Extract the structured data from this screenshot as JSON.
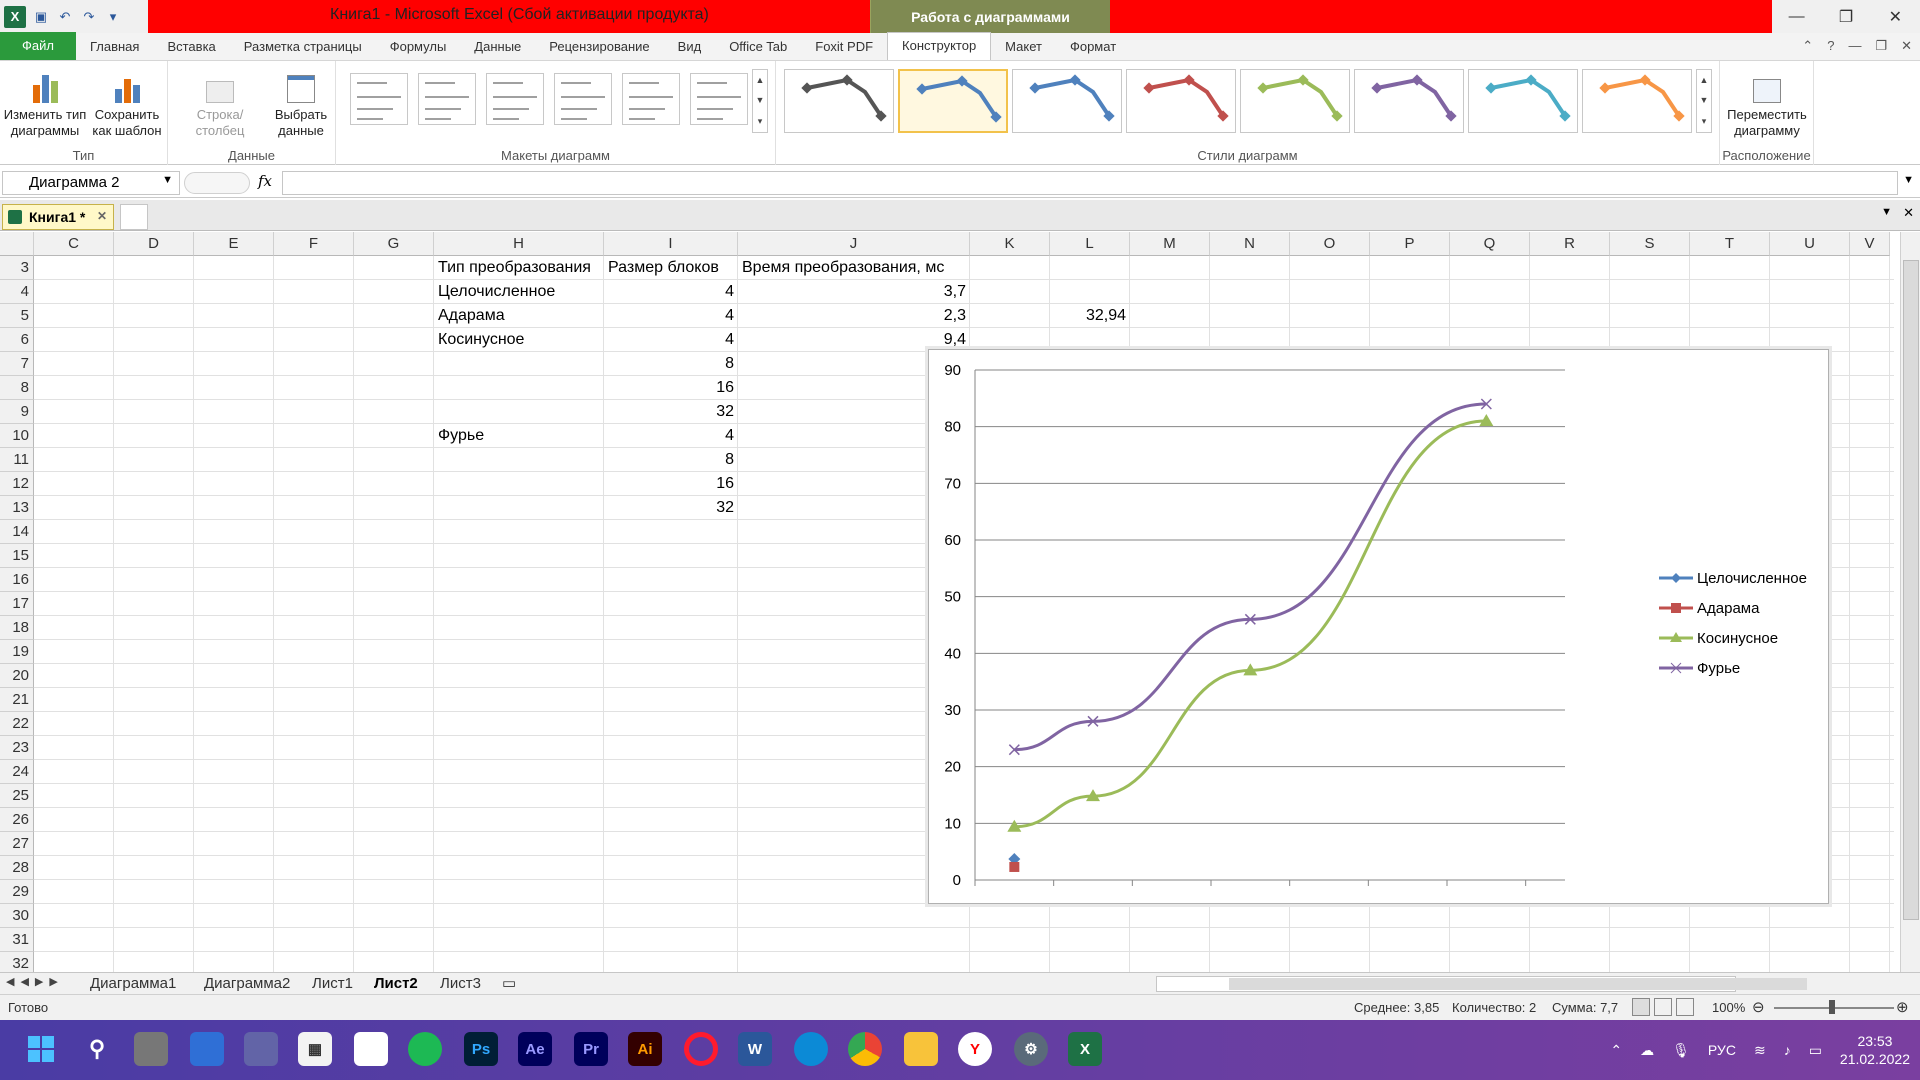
{
  "window": {
    "title": "Книга1 - Microsoft Excel (Сбой активации продукта)",
    "context_tab": "Работа с диаграммами"
  },
  "ribbon_tabs": [
    "Файл",
    "Главная",
    "Вставка",
    "Разметка страницы",
    "Формулы",
    "Данные",
    "Рецензирование",
    "Вид",
    "Office Tab",
    "Foxit PDF",
    "Конструктор",
    "Макет",
    "Формат"
  ],
  "active_tab": "Конструктор",
  "ribbon": {
    "type_group": {
      "label": "Тип",
      "change_type": "Изменить тип диаграммы",
      "save_template": "Сохранить как шаблон"
    },
    "data_group": {
      "label": "Данные",
      "switch_row_col": "Строка/столбец",
      "select_data": "Выбрать данные"
    },
    "layouts_group": {
      "label": "Макеты диаграмм"
    },
    "styles_group": {
      "label": "Стили диаграмм",
      "colors": [
        "#555555",
        "#4f81bd",
        "#4f81bd",
        "#c0504d",
        "#9bbb59",
        "#8064a2",
        "#4bacc6",
        "#f79646"
      ]
    },
    "location_group": {
      "label": "Расположение",
      "move_chart": "Переместить диаграмму"
    }
  },
  "formula_bar": {
    "name_box": "Диаграмма 2",
    "fx": "fx",
    "formula": ""
  },
  "workbook_tab": "Книга1 *",
  "columns": [
    "C",
    "D",
    "E",
    "F",
    "G",
    "H",
    "I",
    "J",
    "K",
    "L",
    "M",
    "N",
    "O",
    "P",
    "Q",
    "R",
    "S",
    "T",
    "U",
    "V"
  ],
  "rows": [
    "3",
    "4",
    "5",
    "6",
    "7",
    "8",
    "9",
    "10",
    "11",
    "12",
    "13",
    "14",
    "15",
    "16",
    "17",
    "18",
    "19",
    "20",
    "21",
    "22",
    "23",
    "24",
    "25",
    "26",
    "27",
    "28",
    "29",
    "30",
    "31",
    "32"
  ],
  "cells": {
    "H3": "Тип преобразования",
    "I3": "Размер блоков",
    "J3": "Время преобразования, мс",
    "H4": "Целочисленное",
    "I4": "4",
    "J4": "3,7",
    "H5": "Адарама",
    "I5": "4",
    "J5": "2,3",
    "L5": "32,94",
    "H6": "Косинусное",
    "I6": "4",
    "J6": "9,4",
    "I7": "8",
    "I8": "16",
    "I9": "32",
    "H10": "Фурье",
    "I10": "4",
    "I11": "8",
    "I12": "16",
    "I13": "32"
  },
  "chart_data": {
    "type": "line",
    "x": [
      1,
      2,
      3,
      4,
      5,
      6,
      7
    ],
    "ylim": [
      0,
      90
    ],
    "yticks": [
      "0",
      "10",
      "20",
      "30",
      "40",
      "50",
      "60",
      "70",
      "80",
      "90"
    ],
    "grid": true,
    "legend_position": "right",
    "series": [
      {
        "name": "Целочисленное",
        "color": "#4f81bd",
        "marker": "diamond",
        "values": [
          3.7,
          null,
          null,
          null,
          null,
          null,
          null
        ]
      },
      {
        "name": "Адарама",
        "color": "#c0504d",
        "marker": "square",
        "values": [
          2.3,
          null,
          null,
          null,
          null,
          null,
          null
        ]
      },
      {
        "name": "Косинусное",
        "color": "#9bbb59",
        "marker": "triangle",
        "values": [
          9.4,
          14.8,
          null,
          37,
          null,
          null,
          81
        ]
      },
      {
        "name": "Фурье",
        "color": "#8064a2",
        "marker": "x",
        "values": [
          23,
          28,
          null,
          46,
          null,
          null,
          84
        ]
      }
    ]
  },
  "sheet_tabs": [
    "Диаграмма1",
    "Диаграмма2",
    "Лист1",
    "Лист2",
    "Лист3"
  ],
  "active_sheet": "Лист2",
  "status": {
    "ready": "Готово",
    "average": "Среднее: 3,85",
    "count": "Количество: 2",
    "sum": "Сумма: 7,7",
    "zoom": "100%"
  },
  "taskbar": {
    "lang": "РУС",
    "time": "23:53",
    "date": "21.02.2022"
  }
}
